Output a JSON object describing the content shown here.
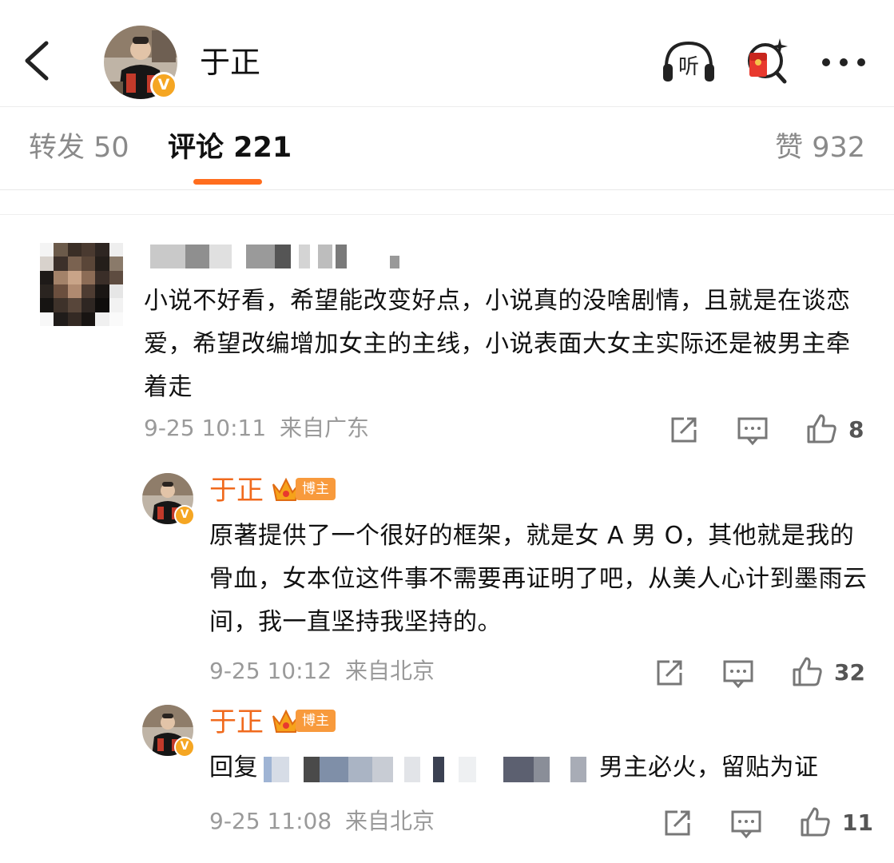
{
  "header": {
    "title": "于正",
    "verified_badge": "V",
    "listen_icon_label": "听",
    "icons": [
      "back-icon",
      "listen-icon",
      "red-packet-icon",
      "more-icon"
    ]
  },
  "tabs": {
    "repost_label": "转发 50",
    "comment_label": "评论 221",
    "like_label": "赞 932",
    "active": "评论 221",
    "accent_color": "#ff6d1e"
  },
  "comments": [
    {
      "text": "小说不好看，希望能改变好点，小说真的没啥剧情，且就是在谈恋爱，希望改编增加女主的主线，小说表面大女主实际还是被男主牵着走",
      "time": "9-25 10:11",
      "location": "来自广东",
      "likes": "8"
    }
  ],
  "replies": [
    {
      "author": "于正",
      "badge": "博主",
      "text": "原著提供了一个很好的框架，就是女 A 男 O，其他就是我的骨血，女本位这件事不需要再证明了吧，从美人心计到墨雨云间，我一直坚持我坚持的。",
      "time": "9-25 10:12",
      "location": "来自北京",
      "likes": "32"
    },
    {
      "author": "于正",
      "badge": "博主",
      "reply_prefix": "回复",
      "text": "男主必火，留贴为证",
      "time": "9-25 11:08",
      "location": "来自北京",
      "likes": "11"
    }
  ]
}
